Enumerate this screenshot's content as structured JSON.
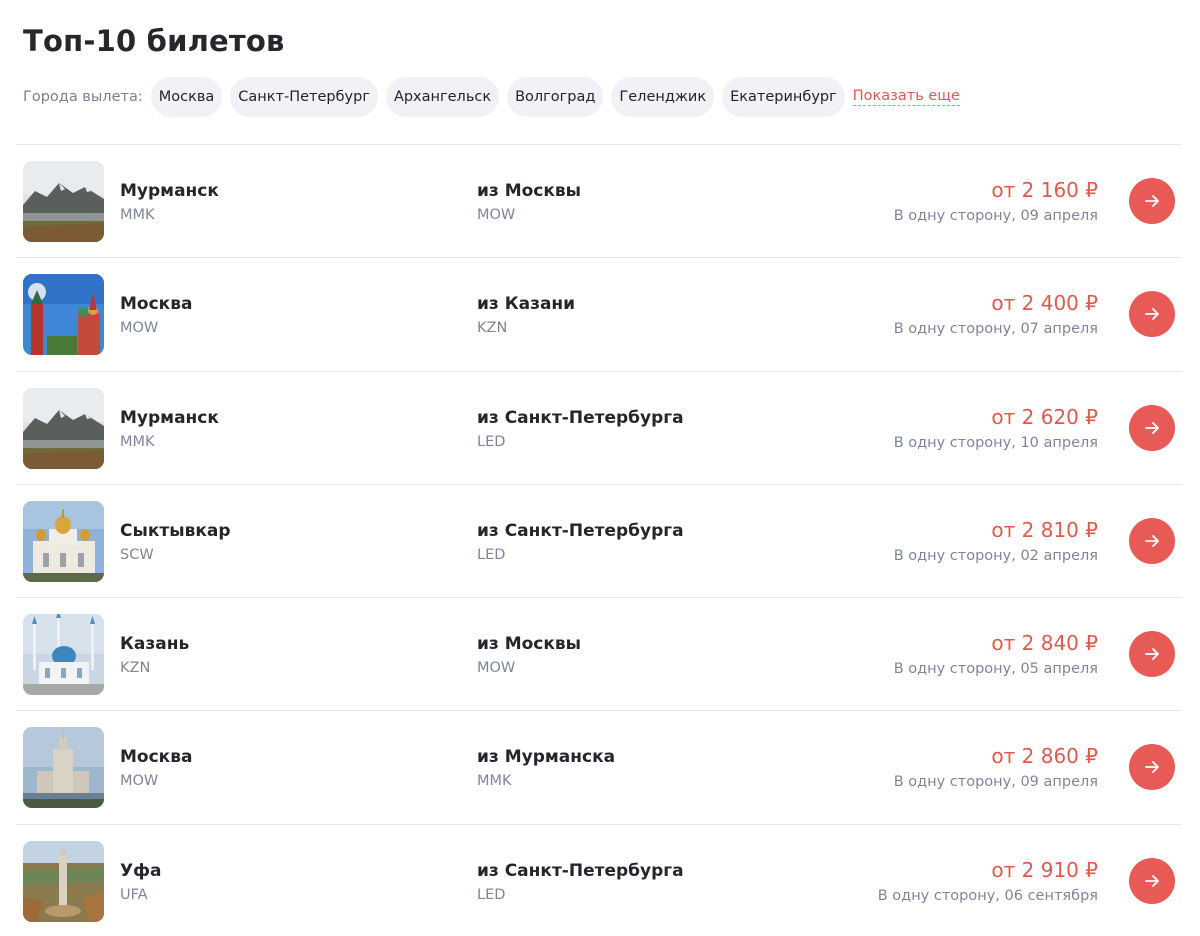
{
  "title": "Топ-10 билетов",
  "filters": {
    "label": "Города вылета:",
    "cities": [
      "Москва",
      "Санкт-Петербург",
      "Архангельск",
      "Волгоград",
      "Геленджик",
      "Екатеринбург"
    ],
    "show_more": "Показать еще"
  },
  "colors": {
    "accent": "#e0594f",
    "button": "#e85a56",
    "muted_text": "#80849a",
    "chip_bg": "#f1f2f6"
  },
  "tickets": [
    {
      "city": "Мурманск",
      "code": "MMK",
      "from": "из Москвы",
      "from_code": "MOW",
      "price": "от 2 160 ₽",
      "date": "В одну сторону, 09 апреля",
      "image": "mountains-lake"
    },
    {
      "city": "Москва",
      "code": "MOW",
      "from": "из Казани",
      "from_code": "KZN",
      "price": "от 2 400 ₽",
      "date": "В одну сторону, 07 апреля",
      "image": "kremlin-towers"
    },
    {
      "city": "Мурманск",
      "code": "MMK",
      "from": "из Санкт-Петербурга",
      "from_code": "LED",
      "price": "от 2 620 ₽",
      "date": "В одну сторону, 10 апреля",
      "image": "mountains-lake"
    },
    {
      "city": "Сыктывкар",
      "code": "SCW",
      "from": "из Санкт-Петербурга",
      "from_code": "LED",
      "price": "от 2 810 ₽",
      "date": "В одну сторону, 02 апреля",
      "image": "cathedral-domes"
    },
    {
      "city": "Казань",
      "code": "KZN",
      "from": "из Москвы",
      "from_code": "MOW",
      "price": "от 2 840 ₽",
      "date": "В одну сторону, 05 апреля",
      "image": "mosque-minarets"
    },
    {
      "city": "Москва",
      "code": "MOW",
      "from": "из Мурманска",
      "from_code": "MMK",
      "price": "от 2 860 ₽",
      "date": "В одну сторону, 09 апреля",
      "image": "stalin-skyscraper"
    },
    {
      "city": "Уфа",
      "code": "UFA",
      "from": "из Санкт-Петербурга",
      "from_code": "LED",
      "price": "от 2 910 ₽",
      "date": "В одну сторону, 06 сентября",
      "image": "monument-park"
    }
  ],
  "row_action_icon": "arrow-right-icon"
}
